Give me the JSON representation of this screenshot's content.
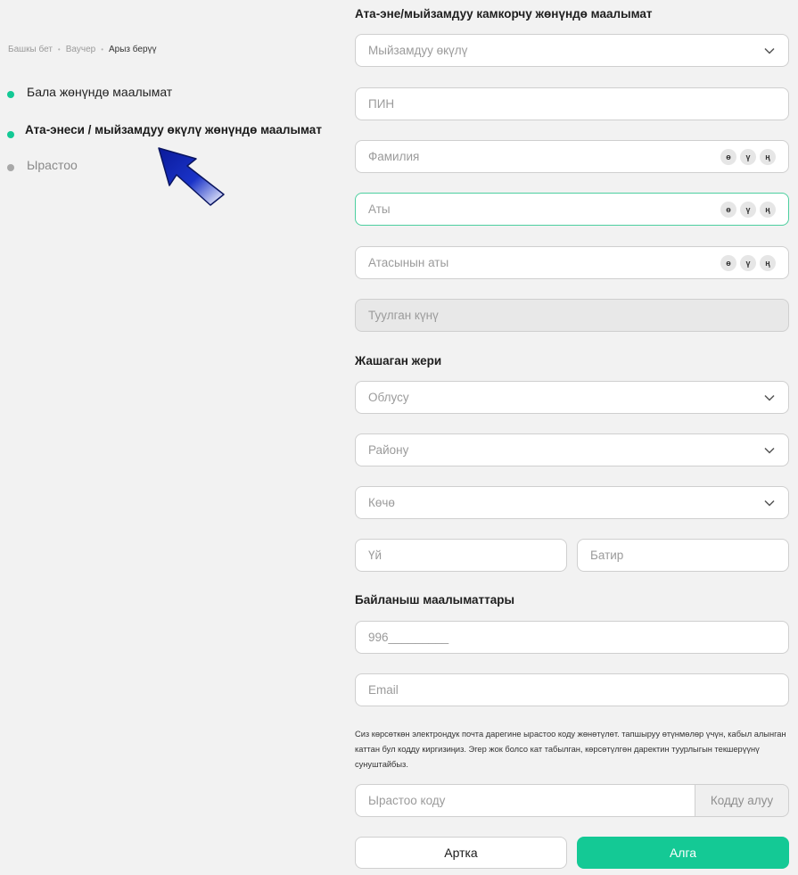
{
  "breadcrumb": {
    "home": "Башкы бет",
    "voucher": "Ваучер",
    "current": "Арыз берүү"
  },
  "steps": [
    {
      "label": "Бала жөнүндө маалымат"
    },
    {
      "label": "Ата-энеси / мыйзамдуу өкүлү жөнүндө маалымат"
    },
    {
      "label": "Ырастоо"
    }
  ],
  "sections": {
    "guardian": "Ата-эне/мыйзамдуу камкорчу жөнүндө маалымат",
    "residence": "Жашаган жери",
    "contacts": "Байланыш маалыматтары"
  },
  "fields": {
    "representative": "Мыйзамдуу өкүлү",
    "pin": "ПИН",
    "surname": "Фамилия",
    "name": "Аты",
    "patronymic": "Атасынын аты",
    "birthdate": "Туулган күнү",
    "region": "Облусу",
    "district": "Району",
    "street": "Көчө",
    "house": "Үй",
    "apartment": "Батир",
    "phone": "996_________",
    "email": "Email",
    "code": "Ырастоо коду"
  },
  "special_chars": [
    "ө",
    "ү",
    "ң"
  ],
  "note": "Сиз көрсөткөн электрондук почта дарегине ырастоо коду жөнөтүлөт. тапшыруу өтүнмөлөр үчүн, кабыл алынган каттан бул кодду киргизиңиз. Эгер жок болсо кат табылган, көрсөтүлгөн даректин туурлыгын текшерүүнү сунуштайбыз.",
  "buttons": {
    "get_code": "Кодду алуу",
    "back": "Артка",
    "next": "Алга"
  },
  "colors": {
    "accent": "#14c995",
    "background": "#f2f2f2",
    "focus_border": "#4ccf9f"
  }
}
